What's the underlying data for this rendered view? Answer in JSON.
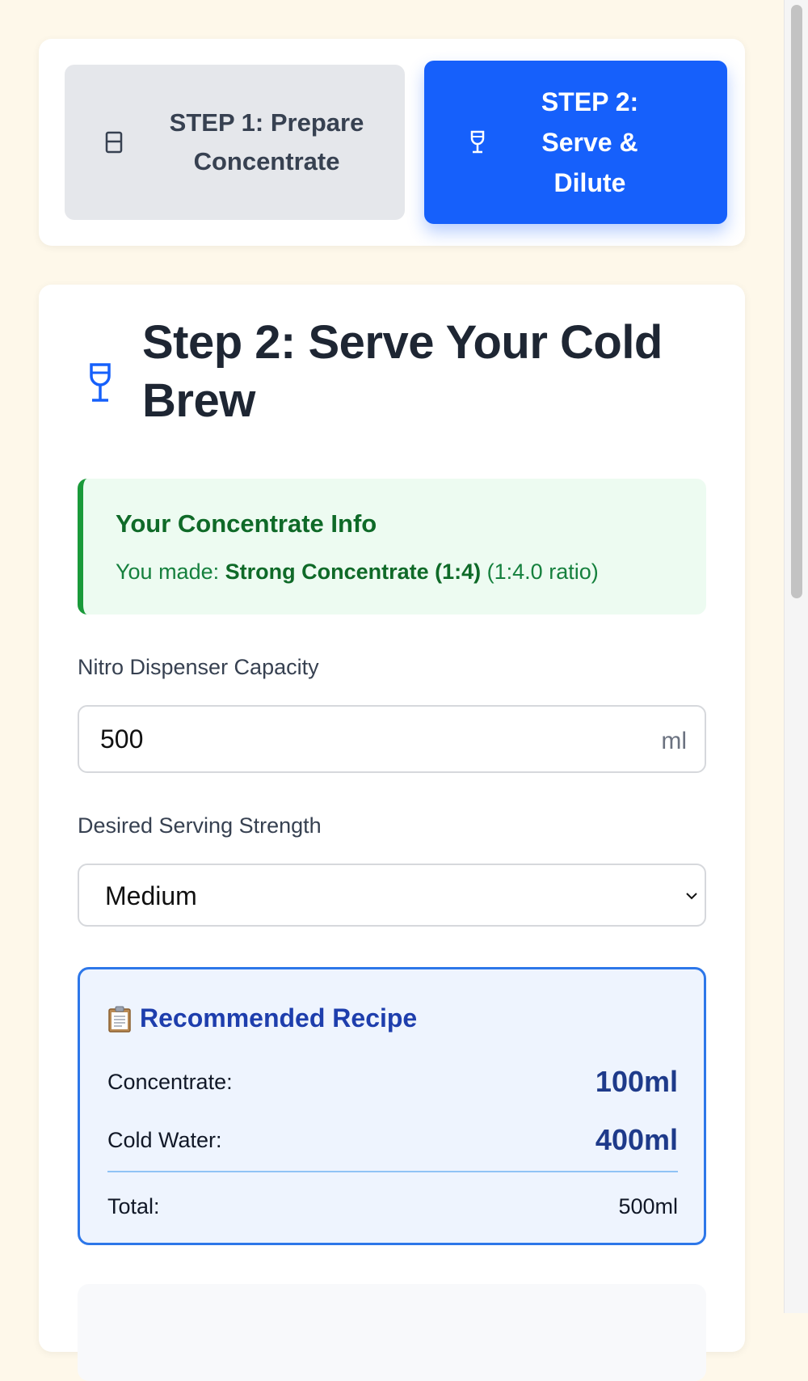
{
  "steps": {
    "step1": {
      "label": "STEP 1: Prepare Concentrate",
      "icon": "cup-icon"
    },
    "step2": {
      "label": "STEP 2: Serve & Dilute",
      "icon": "wine-glass-icon"
    }
  },
  "main": {
    "title": "Step 2: Serve Your Cold Brew",
    "title_icon": "wine-glass-icon"
  },
  "concentrate_info": {
    "title": "Your Concentrate Info",
    "prefix": "You made: ",
    "name": "Strong Concentrate (1:4)",
    "ratio": "(1:4.0 ratio)"
  },
  "capacity": {
    "label": "Nitro Dispenser Capacity",
    "value": "500",
    "unit": "ml"
  },
  "strength": {
    "label": "Desired Serving Strength",
    "value": "Medium"
  },
  "recipe": {
    "icon": "clipboard-icon",
    "title": "Recommended Recipe",
    "concentrate_label": "Concentrate:",
    "concentrate_value": "100ml",
    "water_label": "Cold Water:",
    "water_value": "400ml",
    "total_label": "Total:",
    "total_value": "500ml"
  },
  "colors": {
    "accent": "#1660fb",
    "success": "#15803d",
    "recipe_border": "#2d77e9",
    "page_bg": "#fef8ea"
  }
}
